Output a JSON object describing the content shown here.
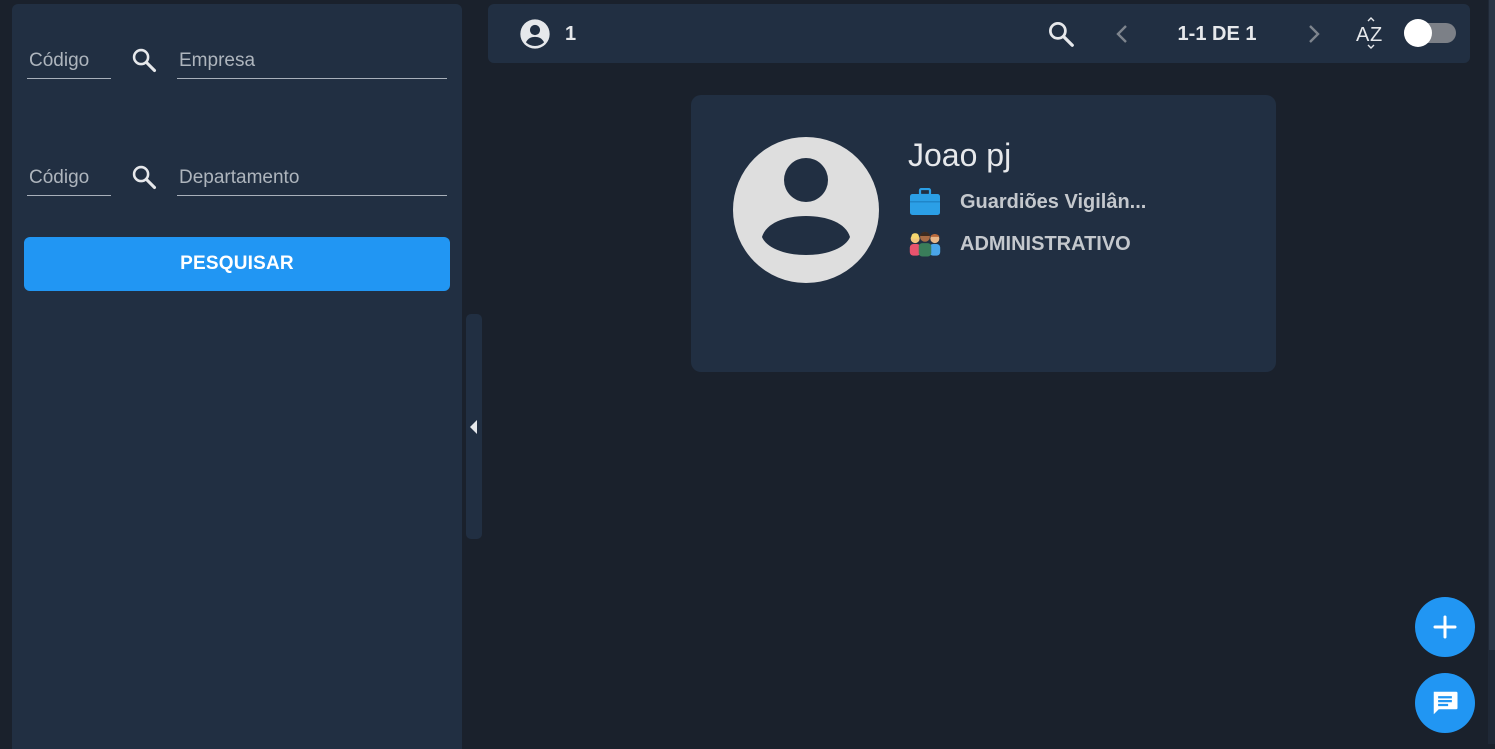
{
  "filters": {
    "empresa": {
      "code_placeholder": "Código",
      "name_placeholder": "Empresa"
    },
    "departamento": {
      "code_placeholder": "Código",
      "name_placeholder": "Departamento"
    },
    "search_button": "PESQUISAR"
  },
  "toolbar": {
    "count": "1",
    "pagination": "1-1 DE 1",
    "sort_toggle_on": false
  },
  "results": [
    {
      "name": "Joao pj",
      "company": "Guardiões Vigilân...",
      "department": "ADMINISTRATIVO"
    }
  ],
  "colors": {
    "accent": "#2196f3",
    "panel": "#212f42",
    "background": "#1a212c"
  },
  "icons": {
    "user_count": "account-circle-icon",
    "search": "search-icon",
    "prev": "chevron-left-icon",
    "next": "chevron-right-icon",
    "sort": "sort-az-icon",
    "company": "briefcase-icon",
    "department": "people-icon",
    "add": "plus-icon",
    "chat": "chat-icon"
  }
}
